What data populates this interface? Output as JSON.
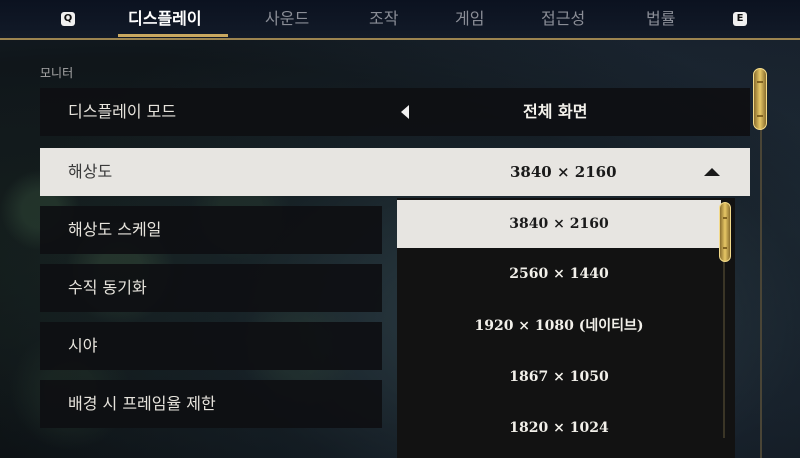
{
  "tabs": {
    "left_key": "Q",
    "right_key": "E",
    "items": [
      "디스플레이",
      "사운드",
      "조작",
      "게임",
      "접근성",
      "법률"
    ],
    "active_index": 0
  },
  "section": {
    "title": "모니터"
  },
  "settings": [
    {
      "label": "디스플레이 모드",
      "value": "전체 화면"
    },
    {
      "label": "해상도",
      "value": "3840 × 2160"
    },
    {
      "label": "해상도 스케일"
    },
    {
      "label": "수직 동기화"
    },
    {
      "label": "시야"
    },
    {
      "label": "배경 시 프레임율 제한"
    }
  ],
  "resolution_dropdown": {
    "options": [
      "3840 × 2160",
      "2560 × 1440",
      "1920 × 1080 (네이티브)",
      "1867 × 1050",
      "1820 × 1024"
    ],
    "selected_index": 0
  },
  "colors": {
    "accent_gold": "#c9a860",
    "selected_row": "#e7e5e1",
    "row_background": "#0e0f12"
  },
  "icons": {
    "display_mode_prev": "chevron-left-icon",
    "resolution_collapse": "chevron-up-icon"
  }
}
